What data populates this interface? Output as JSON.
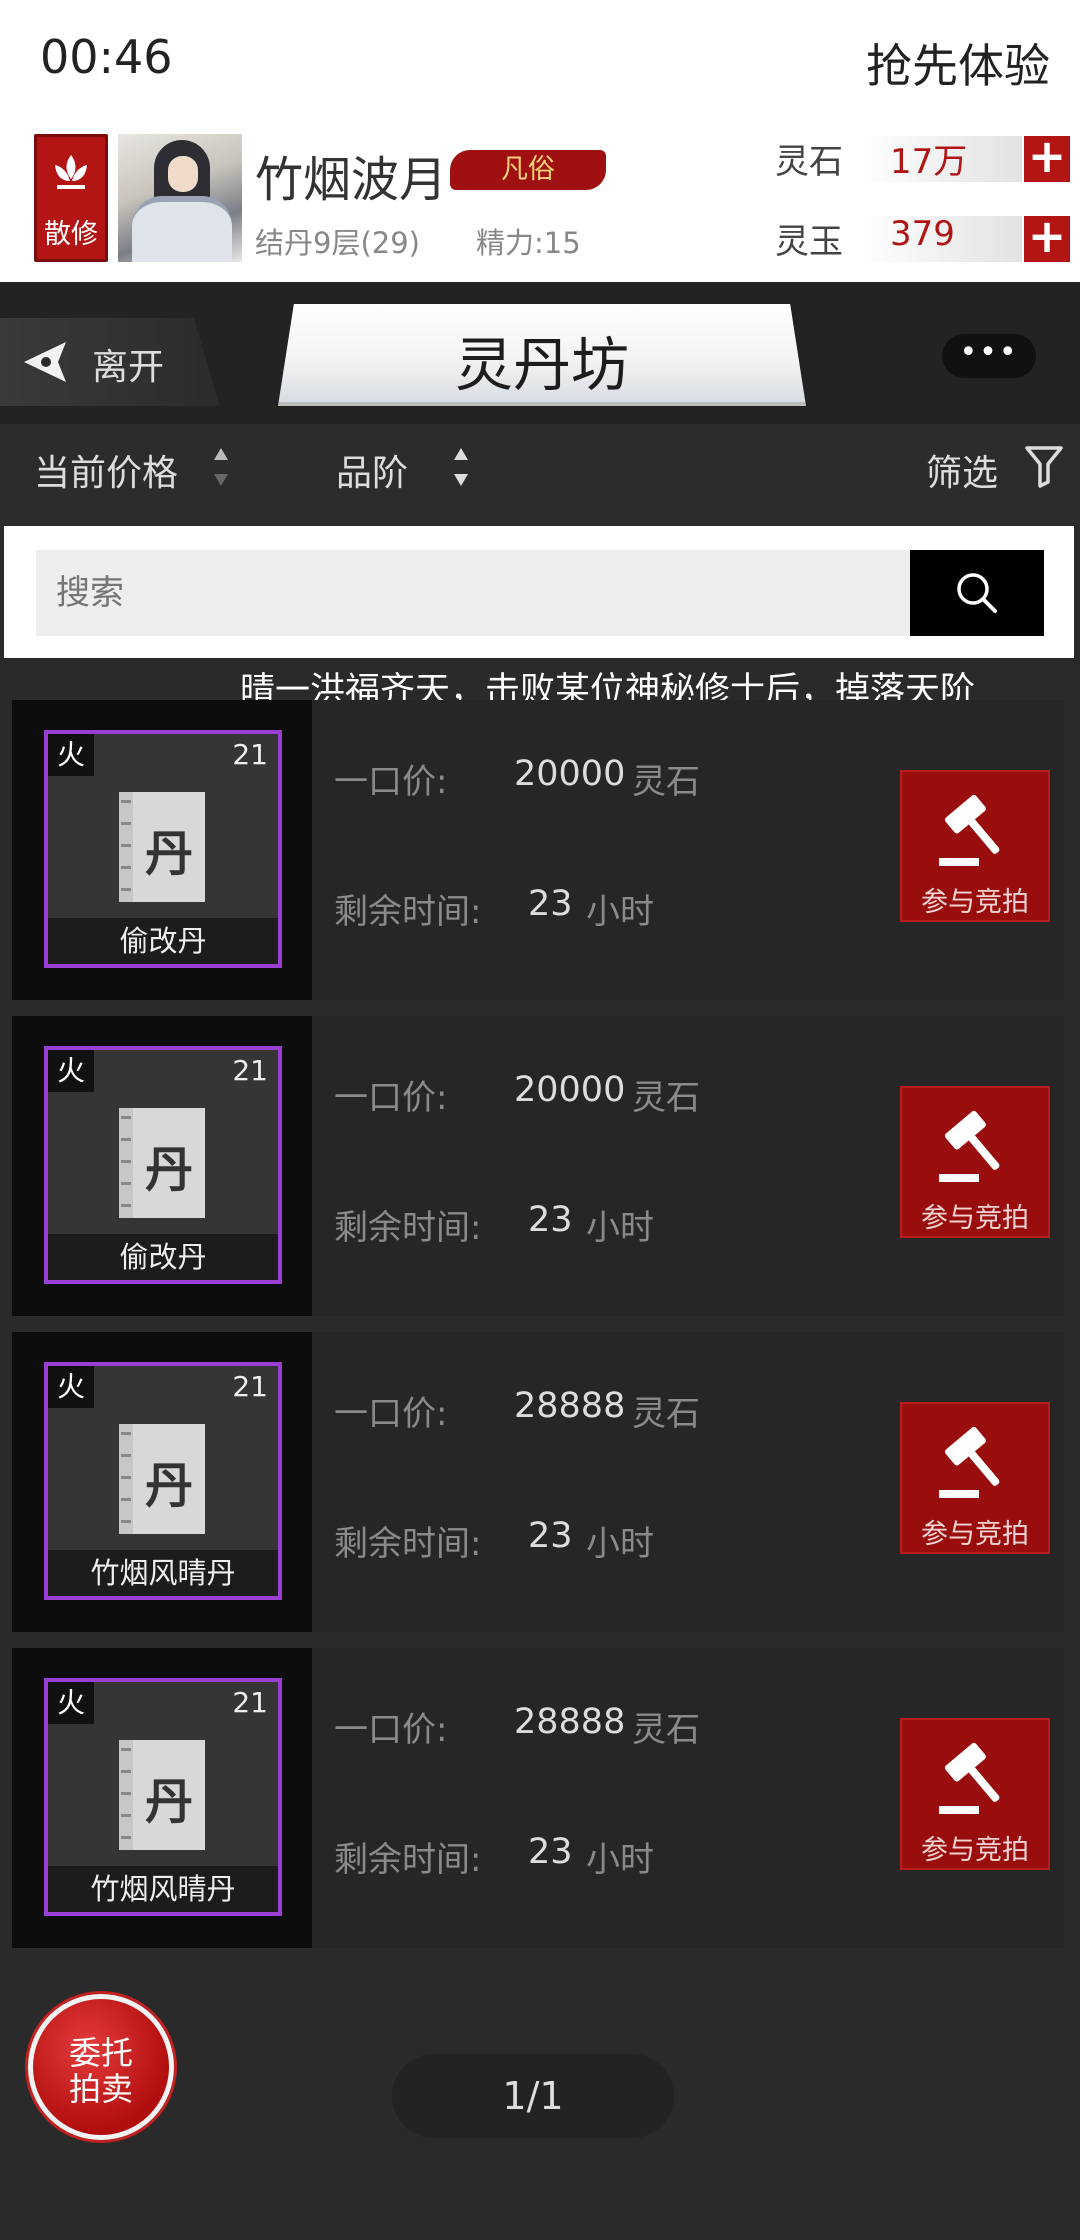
{
  "status": {
    "time": "00:46"
  },
  "header": {
    "early_access": "抢先体验"
  },
  "player": {
    "sect_label": "散修",
    "name": "竹烟波月",
    "rank": "凡俗",
    "level": "结丹9层(29)",
    "energy": "精力:15"
  },
  "resources": [
    {
      "label": "灵石",
      "value": "17万",
      "add": "+"
    },
    {
      "label": "灵玉",
      "value": "379",
      "add": "+"
    }
  ],
  "nav": {
    "back_label": "离开",
    "title": "灵丹坊",
    "more": "•••"
  },
  "sort": {
    "price_label": "当前价格",
    "grade_label": "品阶",
    "filter_label": "筛选"
  },
  "search": {
    "placeholder": "搜索"
  },
  "marquee": "晴一洪福齐天，击败某位神秘修士后，掉落天阶",
  "listing_labels": {
    "price_label": "一口价:",
    "currency": "灵石",
    "time_label": "剩余时间:",
    "time_unit": "小时",
    "bid_label": "参与竞拍",
    "book_char": "丹"
  },
  "listings": [
    {
      "element": "火",
      "count": "21",
      "name": "偷改丹",
      "price": "20000",
      "time": "23"
    },
    {
      "element": "火",
      "count": "21",
      "name": "偷改丹",
      "price": "20000",
      "time": "23"
    },
    {
      "element": "火",
      "count": "21",
      "name": "竹烟风晴丹",
      "price": "28888",
      "time": "23"
    },
    {
      "element": "火",
      "count": "21",
      "name": "竹烟风晴丹",
      "price": "28888",
      "time": "23"
    }
  ],
  "consign": {
    "line1": "委托",
    "line2": "拍卖"
  },
  "pager": "1/1",
  "colors": {
    "accent_red": "#b31515",
    "rarity_purple": "#9b3fd3"
  }
}
